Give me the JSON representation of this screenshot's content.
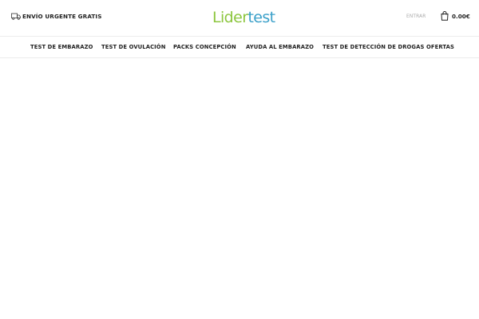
{
  "header": {
    "shipping_text": "ENVÍO URGENTE GRATIS",
    "logo": {
      "part1": "Lider",
      "part2": "test",
      "color_primary": "#8dc63f",
      "color_secondary": "#3aa0c9"
    },
    "login_label": "ENTRAR",
    "cart_total": "0.00€"
  },
  "nav": {
    "items": [
      {
        "label": "TEST DE EMBARAZO"
      },
      {
        "label": "TEST DE OVULACIÓN"
      },
      {
        "label": "PACKS CONCEPCIÓN"
      },
      {
        "label": "AYUDA AL EMBARAZO"
      },
      {
        "label": "TEST DE DETECCIÓN DE DROGAS"
      },
      {
        "label": "OFERTAS"
      }
    ]
  }
}
